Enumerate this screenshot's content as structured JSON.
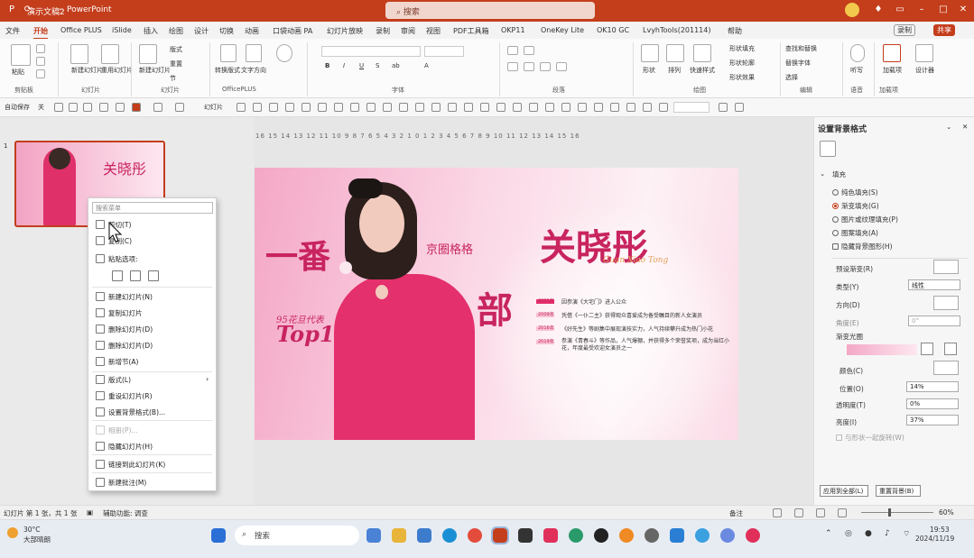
{
  "window": {
    "doc_title": "演示文稿2",
    "app_name": "PowerPoint",
    "search_placeholder": "搜索",
    "share_label": "共享",
    "record_label": "录制"
  },
  "tabs": [
    "文件",
    "开始",
    "Office PLUS",
    "iSlide",
    "插入",
    "绘图",
    "设计",
    "切换",
    "动画",
    "口袋动画 PA",
    "幻灯片放映",
    "录制",
    "审阅",
    "视图",
    "PDF工具箱",
    "OKP11",
    "OneKey Lite",
    "OK10 GC",
    "LvyhTools(201114)",
    "帮助"
  ],
  "active_tab": "开始",
  "ribbon": {
    "groups": [
      "剪贴板",
      "幻灯片",
      "OfficePLUS",
      "字体",
      "段落",
      "绘图",
      "编辑",
      "语音",
      "加载项"
    ],
    "buttons": {
      "paste": "粘贴",
      "new_slide": "新建幻灯片",
      "reuse": "重用幻灯片",
      "layout": "版式",
      "reset": "重置",
      "section": "节",
      "new_slide2": "新建幻灯片",
      "convert_design": "转换版式",
      "text_direction": "文字方向",
      "find_replace": "查找和替换",
      "shape": "形状",
      "arrange": "排列",
      "quick_styles": "快速样式",
      "dictate": "听写",
      "add_ins": "加载项",
      "designer": "设计器",
      "shape_fill": "形状填充",
      "shape_outline": "形状轮廓",
      "shape_effects": "形状效果",
      "replace": "替换字体",
      "select": "选择"
    }
  },
  "qat": {
    "autosave": "自动保存",
    "autosave_state": "关",
    "add_label": "幻灯片"
  },
  "slide_panel_number": "1",
  "ruler_text": "16 15 14 13 12 11 10 9 8 7 6 5 4 3 2 1 0 1 2 3 4 5 6 7 8 9 10 11 12 13 14 15 16",
  "slide": {
    "big_title_left": "一番",
    "big_title_right": "部",
    "tag_line": "京圈格格",
    "name": "关晓彤",
    "name_script": "Guan Xiao Tong",
    "subtitle": "95花旦代表",
    "rank": "Top1",
    "timeline": [
      {
        "year": "2001年",
        "text": "因参演《大宅门》进入公众"
      },
      {
        "year": "2009年",
        "text": "凭借《一仆二主》获得观众喜爱成为备受瞩目的新人女演员"
      },
      {
        "year": "2016年",
        "text": "《好先生》等剧集中展现演技实力，人气持续攀升成为热门小花"
      },
      {
        "year": "2019年",
        "text": "参演《青春斗》等作品，人气爆棚，并获得多个荣誉奖项，成为当红小花，年度最受欢迎女演员之一"
      }
    ]
  },
  "context_menu": {
    "search_placeholder": "搜索菜单",
    "items": [
      {
        "label": "剪切(T)",
        "disabled": false
      },
      {
        "label": "复制(C)",
        "disabled": false
      },
      {
        "label": "粘贴选项:",
        "disabled": false
      },
      {
        "label": "新建幻灯片(N)",
        "disabled": false
      },
      {
        "label": "复制幻灯片",
        "disabled": false
      },
      {
        "label": "删除幻灯片(D)",
        "disabled": false
      },
      {
        "label": "删除幻灯片(D)",
        "disabled": false
      },
      {
        "label": "新增节(A)",
        "disabled": false
      },
      {
        "label": "版式(L)",
        "disabled": false
      },
      {
        "label": "重设幻灯片(R)",
        "disabled": false
      },
      {
        "label": "设置背景格式(B)...",
        "disabled": false
      },
      {
        "label": "相册(P)...",
        "disabled": true
      },
      {
        "label": "隐藏幻灯片(H)",
        "disabled": false
      },
      {
        "label": "链接到此幻灯片(K)",
        "disabled": false
      },
      {
        "label": "新建批注(M)",
        "disabled": false
      }
    ]
  },
  "format_pane": {
    "title": "设置背景格式",
    "section": "填充",
    "fill_options": [
      "纯色填充(S)",
      "渐变填充(G)",
      "图片或纹理填充(P)",
      "图案填充(A)"
    ],
    "selected_fill": "渐变填充(G)",
    "hide_bg_graphics": "隐藏背景图形(H)",
    "preset": "预设渐变(R)",
    "type_label": "类型(Y)",
    "type_value": "线性",
    "direction_label": "方向(D)",
    "angle_label": "角度(E)",
    "angle_value": "0°",
    "stops_label": "渐变光圈",
    "color_label": "颜色(C)",
    "position_label": "位置(O)",
    "position_value": "14%",
    "transparency_label": "透明度(T)",
    "transparency_value": "0%",
    "brightness_label": "亮度(I)",
    "brightness_value": "37%",
    "rotate_label": "与形状一起旋转(W)",
    "apply_all": "应用到全部(L)",
    "reset_bg": "重置背景(B)"
  },
  "status": {
    "slide_info": "幻灯片 第 1 张，共 1 张",
    "accessibility": "辅助功能: 调查",
    "notes": "备注",
    "zoom": "60%"
  },
  "taskbar": {
    "weather_temp": "30°C",
    "weather_desc": "大部晴朗",
    "search": "搜索",
    "time": "19:53",
    "date": "2024/11/19"
  },
  "colors": {
    "accent": "#c43e1c",
    "pink": "#c8245f",
    "taskbar": "#e7ecf3"
  }
}
